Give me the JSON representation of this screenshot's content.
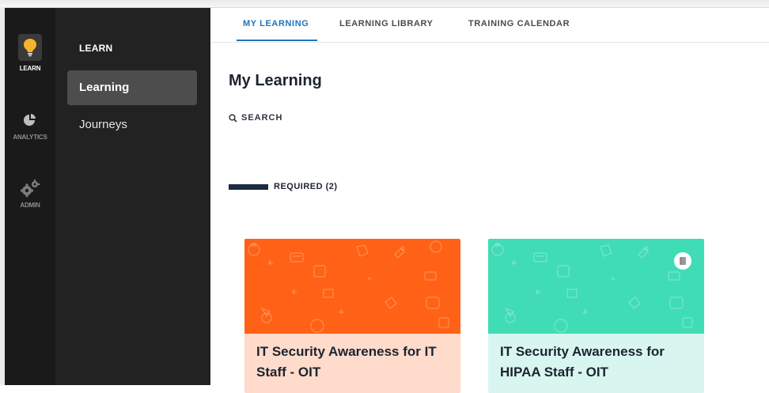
{
  "rail": {
    "items": [
      {
        "label": "LEARN",
        "icon": "lightbulb-icon"
      },
      {
        "label": "ANALYTICS",
        "icon": "pie-chart-icon"
      },
      {
        "label": "ADMIN",
        "icon": "gears-icon"
      }
    ]
  },
  "subnav": {
    "title": "LEARN",
    "items": [
      {
        "label": "Learning"
      },
      {
        "label": "Journeys"
      }
    ]
  },
  "tabs": [
    {
      "label": "MY LEARNING"
    },
    {
      "label": "LEARNING LIBRARY"
    },
    {
      "label": "TRAINING CALENDAR"
    }
  ],
  "main": {
    "title": "My Learning",
    "search_label": "SEARCH",
    "section_label": "REQUIRED (2)"
  },
  "cards": [
    {
      "title": "IT Security Awareness for IT Staff - OIT",
      "banner_color": "#ff6216",
      "body_color": "#fedbca"
    },
    {
      "title": "IT Security Awareness for HIPAA Staff - OIT",
      "banner_color": "#40dcb6",
      "body_color": "#d8f6ef",
      "badge_icon": "book-icon"
    }
  ],
  "colors": {
    "accent": "#1f74b8",
    "rail_bg": "#1a1a1a",
    "subnav_bg": "#222222",
    "lightbulb": "#f7b32b"
  }
}
